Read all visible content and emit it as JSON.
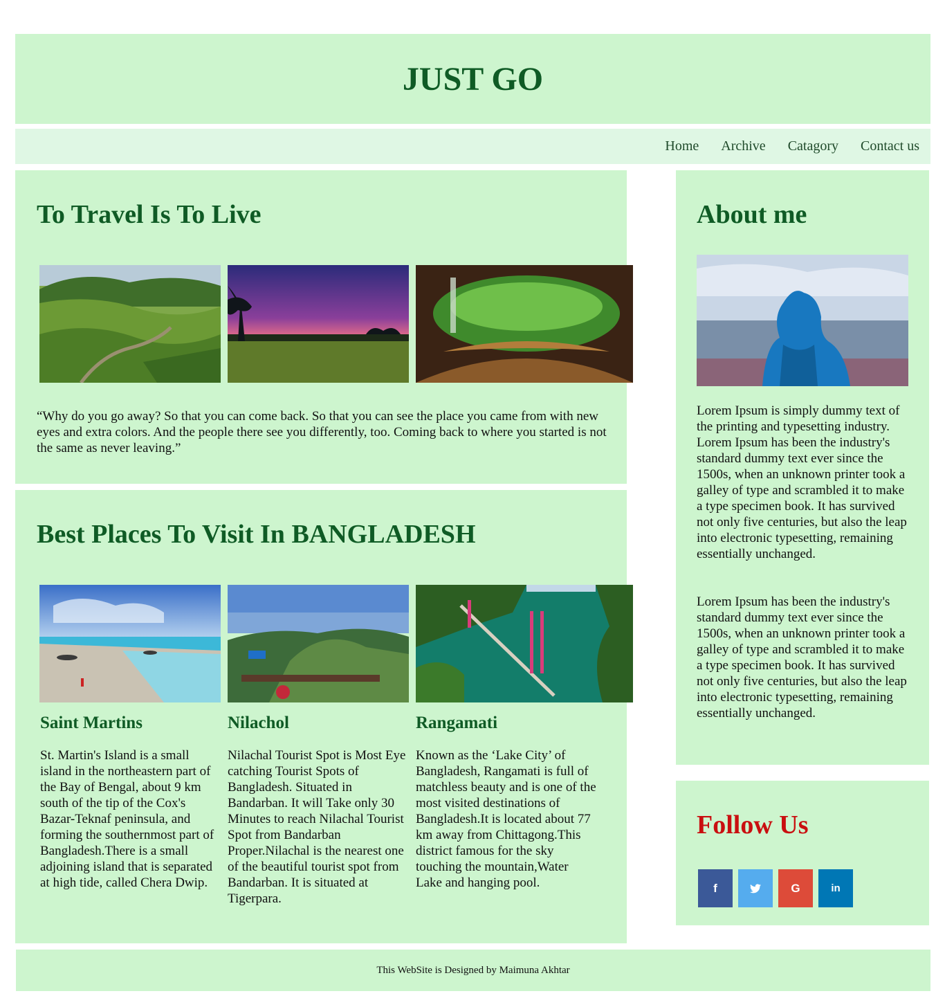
{
  "site": {
    "title": "JUST GO"
  },
  "nav": {
    "items": [
      "Home",
      "Archive",
      "Catagory",
      "Contact us"
    ]
  },
  "travel": {
    "heading": "To Travel Is To Live",
    "quote": "“Why do you go away? So that you can come back. So that you can see the place you came from with new eyes and extra colors. And the people there see you differently, too. Coming back to where you started is not the same as never leaving.”"
  },
  "places": {
    "heading": "Best Places To Visit In BANGLADESH",
    "items": [
      {
        "name": "Saint Martins",
        "text": "St. Martin's Island is a small island in the northeastern part of the Bay of Bengal, about 9 km south of the tip of the Cox's Bazar-Teknaf peninsula, and forming the southernmost part of Bangladesh.There is a small adjoining island that is separated at high tide, called Chera Dwip."
      },
      {
        "name": "Nilachol",
        "text": "Nilachal Tourist Spot is Most Eye catching Tourist Spots of Bangladesh. Situated in Bandarban. It will Take only 30 Minutes to reach Nilachal Tourist Spot from Bandarban Proper.Nilachal is the nearest one of the beautiful tourist spot from Bandarban. It is situated at Tigerpara."
      },
      {
        "name": "Rangamati",
        "text": "Known as the ‘Lake City’ of Bangladesh, Rangamati is full of matchless beauty and is one of the most visited destinations of Bangladesh.It is located about 77 km away from Chittagong.This district famous for the sky touching the mountain,Water Lake and hanging pool."
      }
    ]
  },
  "about": {
    "heading": "About me",
    "p1": "Lorem Ipsum is simply dummy text of the printing and typesetting industry. Lorem Ipsum has been the industry's standard dummy text ever since the 1500s, when an unknown printer took a galley of type and scrambled it to make a type specimen book. It has survived not only five centuries, but also the leap into electronic typesetting, remaining essentially unchanged.",
    "p2": "Lorem Ipsum has been the industry's standard dummy text ever since the 1500s, when an unknown printer took a galley of type and scrambled it to make a type specimen book. It has survived not only five centuries, but also the leap into electronic typesetting, remaining essentially unchanged."
  },
  "follow": {
    "heading": "Follow Us",
    "icons": [
      {
        "name": "facebook-icon",
        "glyph": "f",
        "color": "#3b5998"
      },
      {
        "name": "twitter-icon",
        "glyph": "🐦",
        "color": "#55acee"
      },
      {
        "name": "google-icon",
        "glyph": "G",
        "color": "#dd4b39"
      },
      {
        "name": "linkedin-icon",
        "glyph": "in",
        "color": "#0077b5"
      }
    ]
  },
  "footer": {
    "text": "This WebSite is Designed by Maimuna Akhtar"
  },
  "colors": {
    "card_bg": "#cdf5ce",
    "nav_bg": "#dff7e4",
    "heading": "#0f5b25",
    "follow_heading": "#c90f10"
  }
}
